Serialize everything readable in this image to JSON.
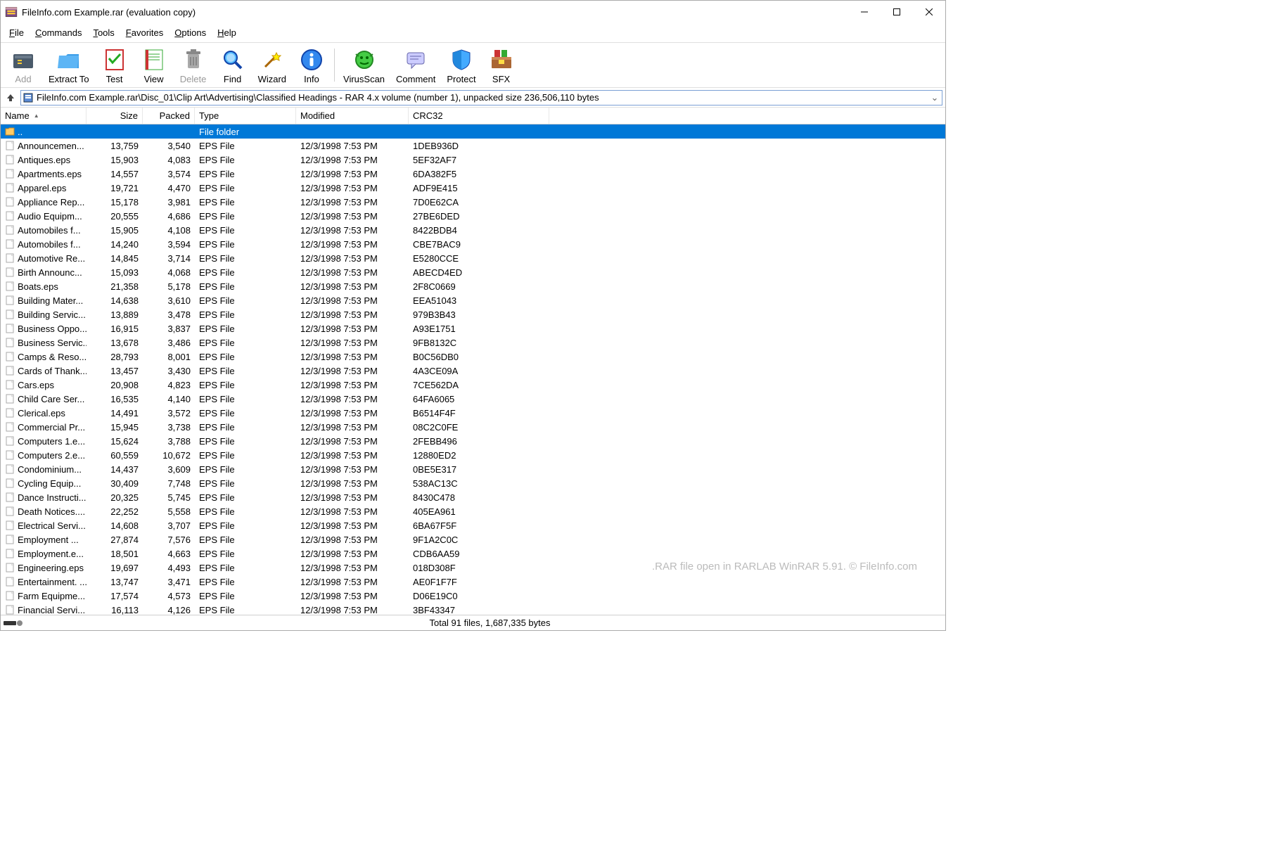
{
  "title": "FileInfo.com Example.rar (evaluation copy)",
  "menu": [
    "File",
    "Commands",
    "Tools",
    "Favorites",
    "Options",
    "Help"
  ],
  "toolbar": [
    {
      "label": "Add",
      "icon": "add",
      "disabled": true
    },
    {
      "label": "Extract To",
      "icon": "extract"
    },
    {
      "label": "Test",
      "icon": "test"
    },
    {
      "label": "View",
      "icon": "view"
    },
    {
      "label": "Delete",
      "icon": "delete",
      "disabled": true
    },
    {
      "label": "Find",
      "icon": "find"
    },
    {
      "label": "Wizard",
      "icon": "wizard"
    },
    {
      "label": "Info",
      "icon": "info"
    },
    {
      "sep": true
    },
    {
      "label": "VirusScan",
      "icon": "virus"
    },
    {
      "label": "Comment",
      "icon": "comment"
    },
    {
      "label": "Protect",
      "icon": "protect"
    },
    {
      "label": "SFX",
      "icon": "sfx"
    }
  ],
  "path": "FileInfo.com Example.rar\\Disc_01\\Clip Art\\Advertising\\Classified Headings - RAR 4.x volume (number 1), unpacked size 236,506,110 bytes",
  "columns": {
    "name": "Name",
    "size": "Size",
    "packed": "Packed",
    "type": "Type",
    "modified": "Modified",
    "crc": "CRC32"
  },
  "parent_row": {
    "name": "..",
    "type": "File folder"
  },
  "rows": [
    {
      "name": "Announcemen...",
      "size": "13,759",
      "packed": "3,540",
      "type": "EPS File",
      "modified": "12/3/1998 7:53 PM",
      "crc": "1DEB936D"
    },
    {
      "name": "Antiques.eps",
      "size": "15,903",
      "packed": "4,083",
      "type": "EPS File",
      "modified": "12/3/1998 7:53 PM",
      "crc": "5EF32AF7"
    },
    {
      "name": "Apartments.eps",
      "size": "14,557",
      "packed": "3,574",
      "type": "EPS File",
      "modified": "12/3/1998 7:53 PM",
      "crc": "6DA382F5"
    },
    {
      "name": "Apparel.eps",
      "size": "19,721",
      "packed": "4,470",
      "type": "EPS File",
      "modified": "12/3/1998 7:53 PM",
      "crc": "ADF9E415"
    },
    {
      "name": "Appliance Rep...",
      "size": "15,178",
      "packed": "3,981",
      "type": "EPS File",
      "modified": "12/3/1998 7:53 PM",
      "crc": "7D0E62CA"
    },
    {
      "name": "Audio Equipm...",
      "size": "20,555",
      "packed": "4,686",
      "type": "EPS File",
      "modified": "12/3/1998 7:53 PM",
      "crc": "27BE6DED"
    },
    {
      "name": "Automobiles f...",
      "size": "15,905",
      "packed": "4,108",
      "type": "EPS File",
      "modified": "12/3/1998 7:53 PM",
      "crc": "8422BDB4"
    },
    {
      "name": "Automobiles f...",
      "size": "14,240",
      "packed": "3,594",
      "type": "EPS File",
      "modified": "12/3/1998 7:53 PM",
      "crc": "CBE7BAC9"
    },
    {
      "name": "Automotive Re...",
      "size": "14,845",
      "packed": "3,714",
      "type": "EPS File",
      "modified": "12/3/1998 7:53 PM",
      "crc": "E5280CCE"
    },
    {
      "name": "Birth Announc...",
      "size": "15,093",
      "packed": "4,068",
      "type": "EPS File",
      "modified": "12/3/1998 7:53 PM",
      "crc": "ABECD4ED"
    },
    {
      "name": "Boats.eps",
      "size": "21,358",
      "packed": "5,178",
      "type": "EPS File",
      "modified": "12/3/1998 7:53 PM",
      "crc": "2F8C0669"
    },
    {
      "name": "Building Mater...",
      "size": "14,638",
      "packed": "3,610",
      "type": "EPS File",
      "modified": "12/3/1998 7:53 PM",
      "crc": "EEA51043"
    },
    {
      "name": "Building Servic...",
      "size": "13,889",
      "packed": "3,478",
      "type": "EPS File",
      "modified": "12/3/1998 7:53 PM",
      "crc": "979B3B43"
    },
    {
      "name": "Business Oppo...",
      "size": "16,915",
      "packed": "3,837",
      "type": "EPS File",
      "modified": "12/3/1998 7:53 PM",
      "crc": "A93E1751"
    },
    {
      "name": "Business Servic...",
      "size": "13,678",
      "packed": "3,486",
      "type": "EPS File",
      "modified": "12/3/1998 7:53 PM",
      "crc": "9FB8132C"
    },
    {
      "name": "Camps & Reso...",
      "size": "28,793",
      "packed": "8,001",
      "type": "EPS File",
      "modified": "12/3/1998 7:53 PM",
      "crc": "B0C56DB0"
    },
    {
      "name": "Cards of Thank...",
      "size": "13,457",
      "packed": "3,430",
      "type": "EPS File",
      "modified": "12/3/1998 7:53 PM",
      "crc": "4A3CE09A"
    },
    {
      "name": "Cars.eps",
      "size": "20,908",
      "packed": "4,823",
      "type": "EPS File",
      "modified": "12/3/1998 7:53 PM",
      "crc": "7CE562DA"
    },
    {
      "name": "Child Care Ser...",
      "size": "16,535",
      "packed": "4,140",
      "type": "EPS File",
      "modified": "12/3/1998 7:53 PM",
      "crc": "64FA6065"
    },
    {
      "name": "Clerical.eps",
      "size": "14,491",
      "packed": "3,572",
      "type": "EPS File",
      "modified": "12/3/1998 7:53 PM",
      "crc": "B6514F4F"
    },
    {
      "name": "Commercial Pr...",
      "size": "15,945",
      "packed": "3,738",
      "type": "EPS File",
      "modified": "12/3/1998 7:53 PM",
      "crc": "08C2C0FE"
    },
    {
      "name": "Computers 1.e...",
      "size": "15,624",
      "packed": "3,788",
      "type": "EPS File",
      "modified": "12/3/1998 7:53 PM",
      "crc": "2FEBB496"
    },
    {
      "name": "Computers 2.e...",
      "size": "60,559",
      "packed": "10,672",
      "type": "EPS File",
      "modified": "12/3/1998 7:53 PM",
      "crc": "12880ED2"
    },
    {
      "name": "Condominium...",
      "size": "14,437",
      "packed": "3,609",
      "type": "EPS File",
      "modified": "12/3/1998 7:53 PM",
      "crc": "0BE5E317"
    },
    {
      "name": "Cycling Equip...",
      "size": "30,409",
      "packed": "7,748",
      "type": "EPS File",
      "modified": "12/3/1998 7:53 PM",
      "crc": "538AC13C"
    },
    {
      "name": "Dance Instructi...",
      "size": "20,325",
      "packed": "5,745",
      "type": "EPS File",
      "modified": "12/3/1998 7:53 PM",
      "crc": "8430C478"
    },
    {
      "name": "Death Notices....",
      "size": "22,252",
      "packed": "5,558",
      "type": "EPS File",
      "modified": "12/3/1998 7:53 PM",
      "crc": "405EA961"
    },
    {
      "name": "Electrical Servi...",
      "size": "14,608",
      "packed": "3,707",
      "type": "EPS File",
      "modified": "12/3/1998 7:53 PM",
      "crc": "6BA67F5F"
    },
    {
      "name": "Employment ...",
      "size": "27,874",
      "packed": "7,576",
      "type": "EPS File",
      "modified": "12/3/1998 7:53 PM",
      "crc": "9F1A2C0C"
    },
    {
      "name": "Employment.e...",
      "size": "18,501",
      "packed": "4,663",
      "type": "EPS File",
      "modified": "12/3/1998 7:53 PM",
      "crc": "CDB6AA59"
    },
    {
      "name": "Engineering.eps",
      "size": "19,697",
      "packed": "4,493",
      "type": "EPS File",
      "modified": "12/3/1998 7:53 PM",
      "crc": "018D308F"
    },
    {
      "name": "Entertainment. ...",
      "size": "13,747",
      "packed": "3,471",
      "type": "EPS File",
      "modified": "12/3/1998 7:53 PM",
      "crc": "AE0F1F7F"
    },
    {
      "name": "Farm Equipme...",
      "size": "17,574",
      "packed": "4,573",
      "type": "EPS File",
      "modified": "12/3/1998 7:53 PM",
      "crc": "D06E19C0"
    },
    {
      "name": "Financial Servi...",
      "size": "16,113",
      "packed": "4,126",
      "type": "EPS File",
      "modified": "12/3/1998 7:53 PM",
      "crc": "3BF43347"
    }
  ],
  "status": "Total 91 files, 1,687,335 bytes",
  "watermark": ".RAR file open in RARLAB WinRAR 5.91. © FileInfo.com"
}
